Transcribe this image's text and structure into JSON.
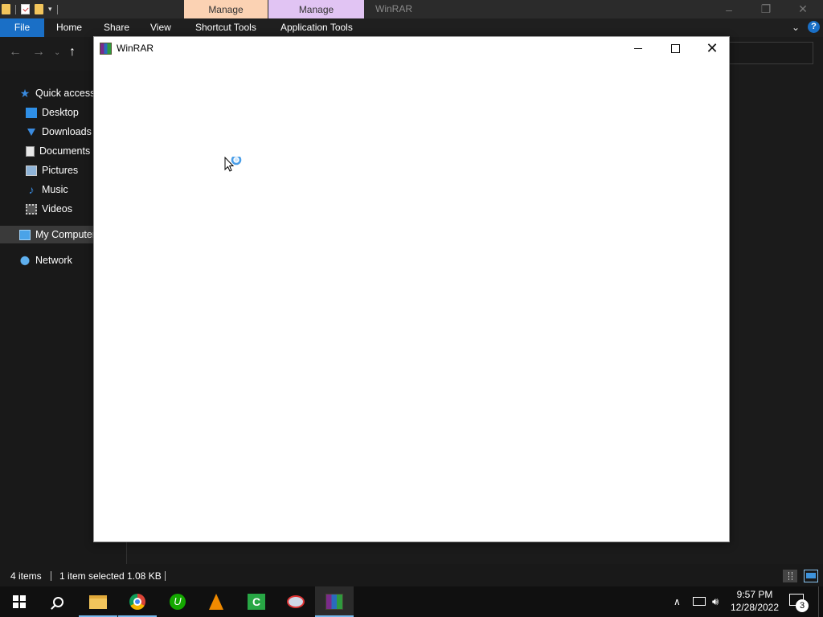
{
  "titlebar": {
    "context_tabs": [
      "Manage",
      "Manage"
    ],
    "window_title": "WinRAR",
    "colors": {
      "manage_picture_tools": "#fbd2b3",
      "manage_application_tools": "#e1c4f3"
    }
  },
  "ribbon": {
    "tabs": [
      "File",
      "Home",
      "Share",
      "View",
      "Shortcut Tools",
      "Application Tools"
    ],
    "help_label": "?"
  },
  "nav_pane": {
    "items": [
      {
        "label": "Quick access",
        "icon": "star-icon"
      },
      {
        "label": "Desktop",
        "icon": "desktop-icon"
      },
      {
        "label": "Downloads",
        "icon": "download-icon"
      },
      {
        "label": "Documents",
        "icon": "documents-icon"
      },
      {
        "label": "Pictures",
        "icon": "pictures-icon"
      },
      {
        "label": "Music",
        "icon": "music-icon"
      },
      {
        "label": "Videos",
        "icon": "videos-icon"
      },
      {
        "label": "My Computer",
        "icon": "computer-icon",
        "selected": true
      },
      {
        "label": "Network",
        "icon": "network-icon"
      }
    ]
  },
  "statusbar": {
    "item_count": "4 items",
    "selection": "1 item selected",
    "size": "1.08 KB"
  },
  "winrar": {
    "title": "WinRAR",
    "state": "loading",
    "close_glyph": "✕"
  },
  "taskbar": {
    "apps": [
      "start-icon",
      "search-icon",
      "file-explorer-icon",
      "chrome-icon",
      "upwork-icon",
      "vlc-icon",
      "camtasia-icon",
      "snipping-tool-icon",
      "winrar-icon"
    ],
    "time": "9:57 PM",
    "date": "12/28/2022",
    "notification_count": "3",
    "accent": "#76b9ed"
  }
}
